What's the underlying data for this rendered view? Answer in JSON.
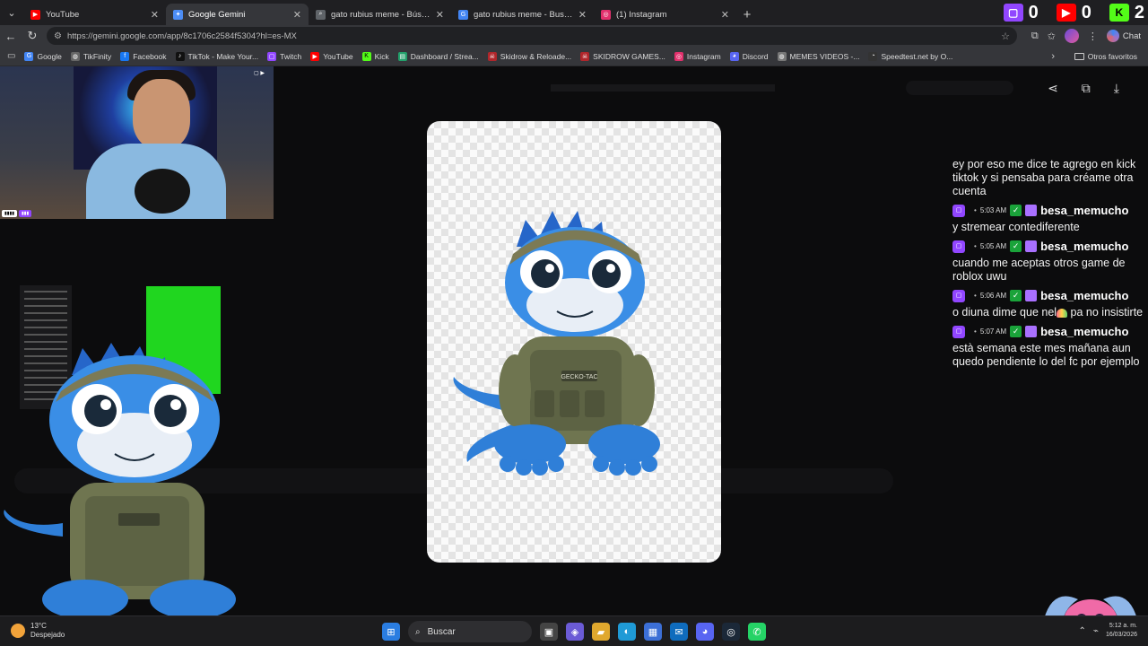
{
  "tabs": [
    {
      "label": "YouTube",
      "favicon_color": "#ff0000",
      "active": false
    },
    {
      "label": "Google Gemini",
      "favicon_color": "#4c8df6",
      "active": true
    },
    {
      "label": "gato rubius meme - Búsqueda",
      "favicon_color": "#5f6368",
      "active": false
    },
    {
      "label": "gato rubius meme - Buscar con Go",
      "favicon_color": "#4285f4",
      "active": false
    },
    {
      "label": "(1) Instagram",
      "favicon_color": "#e1306c",
      "active": false
    }
  ],
  "counters": [
    {
      "platform": "twitch",
      "value": "0",
      "color": "#9146ff",
      "icon": "twitch-icon"
    },
    {
      "platform": "youtube",
      "value": "0",
      "color": "#ff0000",
      "icon": "youtube-icon"
    },
    {
      "platform": "kick",
      "value": "2",
      "color": "#53fc18",
      "icon": "kick-icon"
    }
  ],
  "address": {
    "url": "https://gemini.google.com/app/8c1706c2584f5304?hl=es-MX"
  },
  "chat_button": "Chat",
  "bookmarks": [
    {
      "label": "Google",
      "color": "#4285f4"
    },
    {
      "label": "TikFinity",
      "color": "#666666"
    },
    {
      "label": "Facebook",
      "color": "#1877f2"
    },
    {
      "label": "TikTok - Make Your...",
      "color": "#111111"
    },
    {
      "label": "Twitch",
      "color": "#9146ff"
    },
    {
      "label": "YouTube",
      "color": "#ff0000"
    },
    {
      "label": "Kick",
      "color": "#53fc18"
    },
    {
      "label": "Dashboard / Strea...",
      "color": "#22a06b"
    },
    {
      "label": "Skidrow & Reloade...",
      "color": "#b0262b"
    },
    {
      "label": "SKIDROW GAMES...",
      "color": "#b0262b"
    },
    {
      "label": "Instagram",
      "color": "#e1306c"
    },
    {
      "label": "Discord",
      "color": "#5865f2"
    },
    {
      "label": "MEMES VIDEOS -...",
      "color": "#777777"
    },
    {
      "label": "Speedtest.net by O...",
      "color": "#333333"
    }
  ],
  "other_bookmarks": "Otros favoritos",
  "chat": {
    "intro": "ey por eso me dice te agrego en kick tiktok y si pensaba para créame otra cuenta",
    "messages": [
      {
        "time": "5:03 AM",
        "user": "besa_memucho",
        "text": "y stremear contediferente"
      },
      {
        "time": "5:05 AM",
        "user": "besa_memucho",
        "text": "cuando me aceptas otros game de roblox uwu"
      },
      {
        "time": "5:06 AM",
        "user": "besa_memucho",
        "text_before": "o diuna dime que nel",
        "text_after": " pa no insistirte"
      },
      {
        "time": "5:07 AM",
        "user": "besa_memucho",
        "text": "està semana este mes mañana aun quedo pendiente lo del fc por ejemplo"
      }
    ]
  },
  "patch_labels": [
    "GECKO-TAC"
  ],
  "taskbar": {
    "temperature": "13°C",
    "weather": "Despejado",
    "search_placeholder": "Buscar",
    "time": "5:12 a. m.",
    "date": "16/03/2026"
  }
}
